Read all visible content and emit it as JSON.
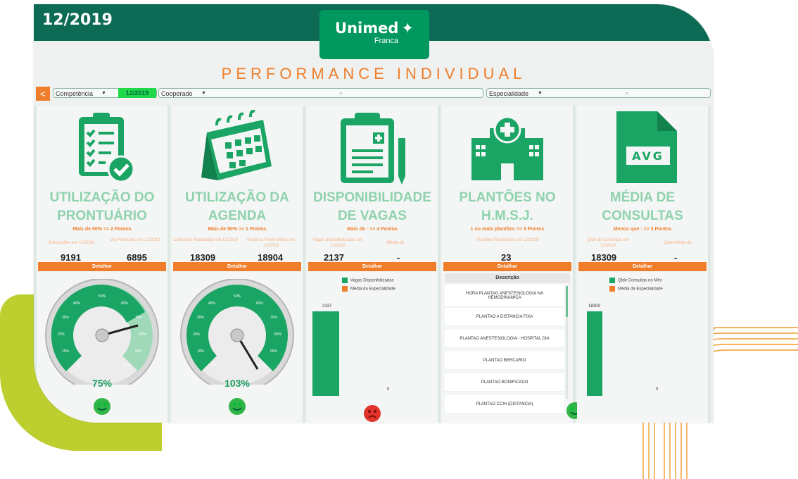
{
  "header": {
    "date": "12/2019",
    "logo_brand": "Unimed",
    "logo_city": "Franca"
  },
  "title": "PERFORMANCE INDIVIDUAL",
  "filters": {
    "back_label": "<",
    "competencia_label": "Competência",
    "competencia_value": "12/2019",
    "cooperado_label": "Cooperado",
    "especialidade_label": "Especialidade"
  },
  "panels": [
    {
      "title1": "UTILIZAÇÃO DO",
      "title2": "PRONTUÁRIO",
      "rule": "Mais de 50% >> 2 Pontos",
      "label_a": "Solicitações em 12/2019",
      "label_b": "Via Prontuário em 12/2019",
      "value_a": "9191",
      "value_b": "6895",
      "detail": "Detalhar",
      "percent": "75%",
      "gauge": {
        "value": 75,
        "max_tick": "100%",
        "ticks": [
          "0%",
          "10%",
          "20%",
          "30%",
          "40%",
          "50%",
          "60%",
          "70%",
          "80%",
          "90%",
          "100%"
        ]
      },
      "mood": "happy"
    },
    {
      "title1": "UTILIZAÇÃO DA",
      "title2": "AGENDA",
      "rule": "Mais de 90% >> 1 Pontos",
      "label_a": "Consultas Realizadas em 12/2019",
      "label_b": "Horários Preenchidos em 12/2019",
      "value_a": "18309",
      "value_b": "18904",
      "detail": "Detalhar",
      "percent": "103%",
      "gauge": {
        "value": 103
      },
      "mood": "happy"
    },
    {
      "title1": "DISPONIBILIDADE",
      "title2": "DE VAGAS",
      "rule": "Mais de : >> 4 Pontos",
      "label_a": "Vagas disponibilizadas em 12/2019",
      "label_b": "Média da",
      "value_a": "2137",
      "value_b": "-",
      "detail": "Detalhar",
      "legend": [
        "Vagas Disponibilizadas",
        "Média da Especialidade"
      ],
      "bars": {
        "series_a": 2137,
        "series_b": 0,
        "label_a": "2137",
        "label_b": "0"
      },
      "mood": "sad"
    },
    {
      "title1": "PLANTÕES NO",
      "title2": "H.M.S.J.",
      "rule": "1 ou mais plantões >> 3 Pontos",
      "label_a": "Plantões Realizados em 12/2019",
      "value_a": "23",
      "detail": "Detalhar",
      "table_header": "Descrição",
      "rows": [
        "HORA PLANTAO ANESTESIOLOGIA NA HEMODINAMICA",
        "PLANTAO A DISTANCIA FIXA",
        "PLANTAO ANESTESIOLOGIA - HOSPITAL DIA",
        "PLANTAO BERCARIO",
        "PLANTAO BONIFICADO",
        "PLANTAO CCIH (DISTANCIA)"
      ],
      "mood": "happy"
    },
    {
      "title1": "MÉDIA DE",
      "title2": "CONSULTAS",
      "rule": "Menos que : >> 3 Pontos",
      "label_a": "Qtde de Consultas em 12/2019",
      "label_b": "Qtde Média da",
      "value_a": "18309",
      "value_b": "-",
      "detail": "Detalhar",
      "legend": [
        "Qtde Consultas no Mês",
        "Média da Especialidade"
      ],
      "bars": {
        "series_a": 18309,
        "series_b": 0,
        "label_a": "18309",
        "label_b": "0"
      },
      "icon_text": "AVG"
    }
  ]
}
